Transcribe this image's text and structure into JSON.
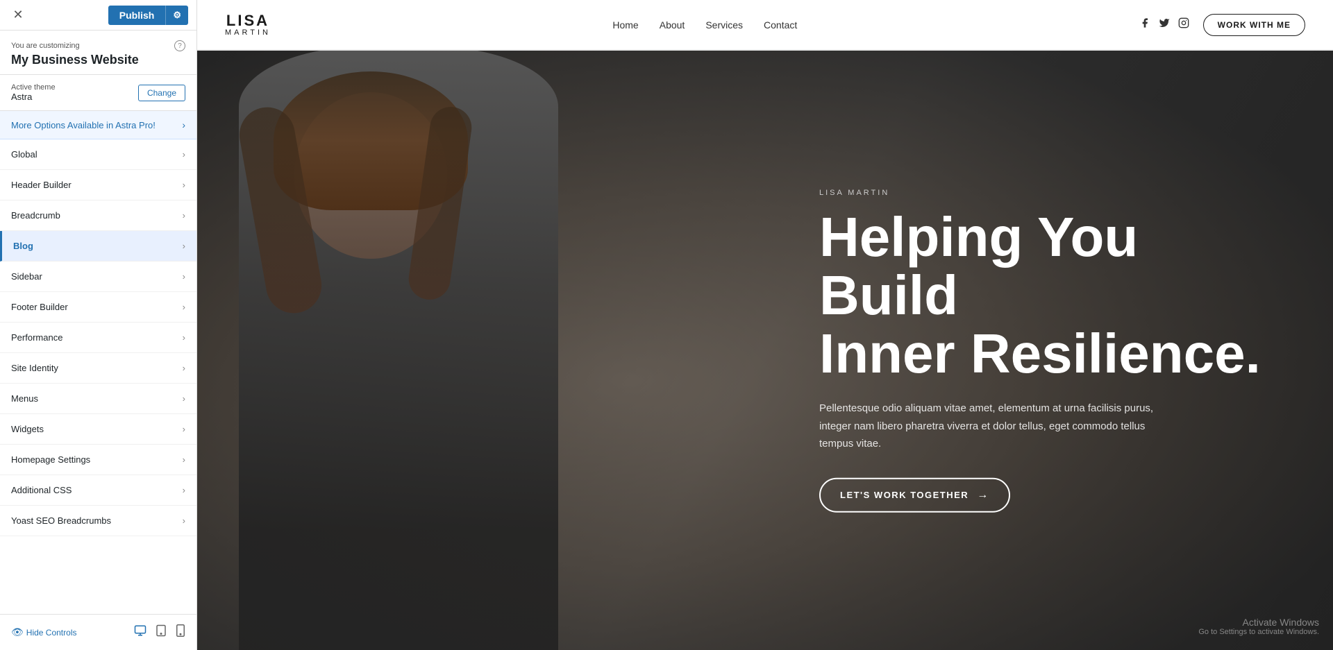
{
  "leftPanel": {
    "closeBtn": "✕",
    "publishBtn": {
      "label": "Publish",
      "gearIcon": "⚙"
    },
    "customizingLabel": "You are customizing",
    "customizingTitle": "My Business Website",
    "helpIcon": "?",
    "theme": {
      "label": "Active theme",
      "name": "Astra",
      "changeBtn": "Change"
    },
    "astraPro": {
      "text": "More Options Available in Astra Pro!",
      "chevron": "›"
    },
    "menuItems": [
      {
        "id": "global",
        "label": "Global",
        "active": false
      },
      {
        "id": "header-builder",
        "label": "Header Builder",
        "active": false
      },
      {
        "id": "breadcrumb",
        "label": "Breadcrumb",
        "active": false
      },
      {
        "id": "blog",
        "label": "Blog",
        "active": true
      },
      {
        "id": "sidebar",
        "label": "Sidebar",
        "active": false
      },
      {
        "id": "footer-builder",
        "label": "Footer Builder",
        "active": false
      },
      {
        "id": "performance",
        "label": "Performance",
        "active": false
      },
      {
        "id": "site-identity",
        "label": "Site Identity",
        "active": false
      },
      {
        "id": "menus",
        "label": "Menus",
        "active": false
      },
      {
        "id": "widgets",
        "label": "Widgets",
        "active": false
      },
      {
        "id": "homepage-settings",
        "label": "Homepage Settings",
        "active": false
      },
      {
        "id": "additional-css",
        "label": "Additional CSS",
        "active": false
      },
      {
        "id": "yoast-seo",
        "label": "Yoast SEO Breadcrumbs",
        "active": false
      }
    ],
    "bottomBar": {
      "hideControls": "Hide Controls",
      "viewIcons": [
        "desktop",
        "tablet",
        "mobile"
      ]
    }
  },
  "website": {
    "logo": {
      "name": "LISA",
      "sub": "MARTIN"
    },
    "nav": {
      "links": [
        "Home",
        "About",
        "Services",
        "Contact"
      ]
    },
    "socialIcons": [
      "facebook",
      "twitter",
      "instagram"
    ],
    "workWithMeBtn": "WORK WITH ME",
    "hero": {
      "tagline": "LISA MARTIN",
      "heading": "Helping You Build\nInner Resilience.",
      "headingLine1": "Helping You Build",
      "headingLine2": "Inner Resilience.",
      "subtext": "Pellentesque odio aliquam vitae amet, elementum at urna facilisis purus, integer nam libero pharetra viverra et dolor tellus, eget commodo tellus tempus vitae.",
      "ctaLabel": "LET'S WORK TOGETHER",
      "ctaArrow": "→"
    },
    "windowsWatermark": {
      "title": "Activate Windows",
      "sub": "Go to Settings to activate Windows."
    }
  }
}
